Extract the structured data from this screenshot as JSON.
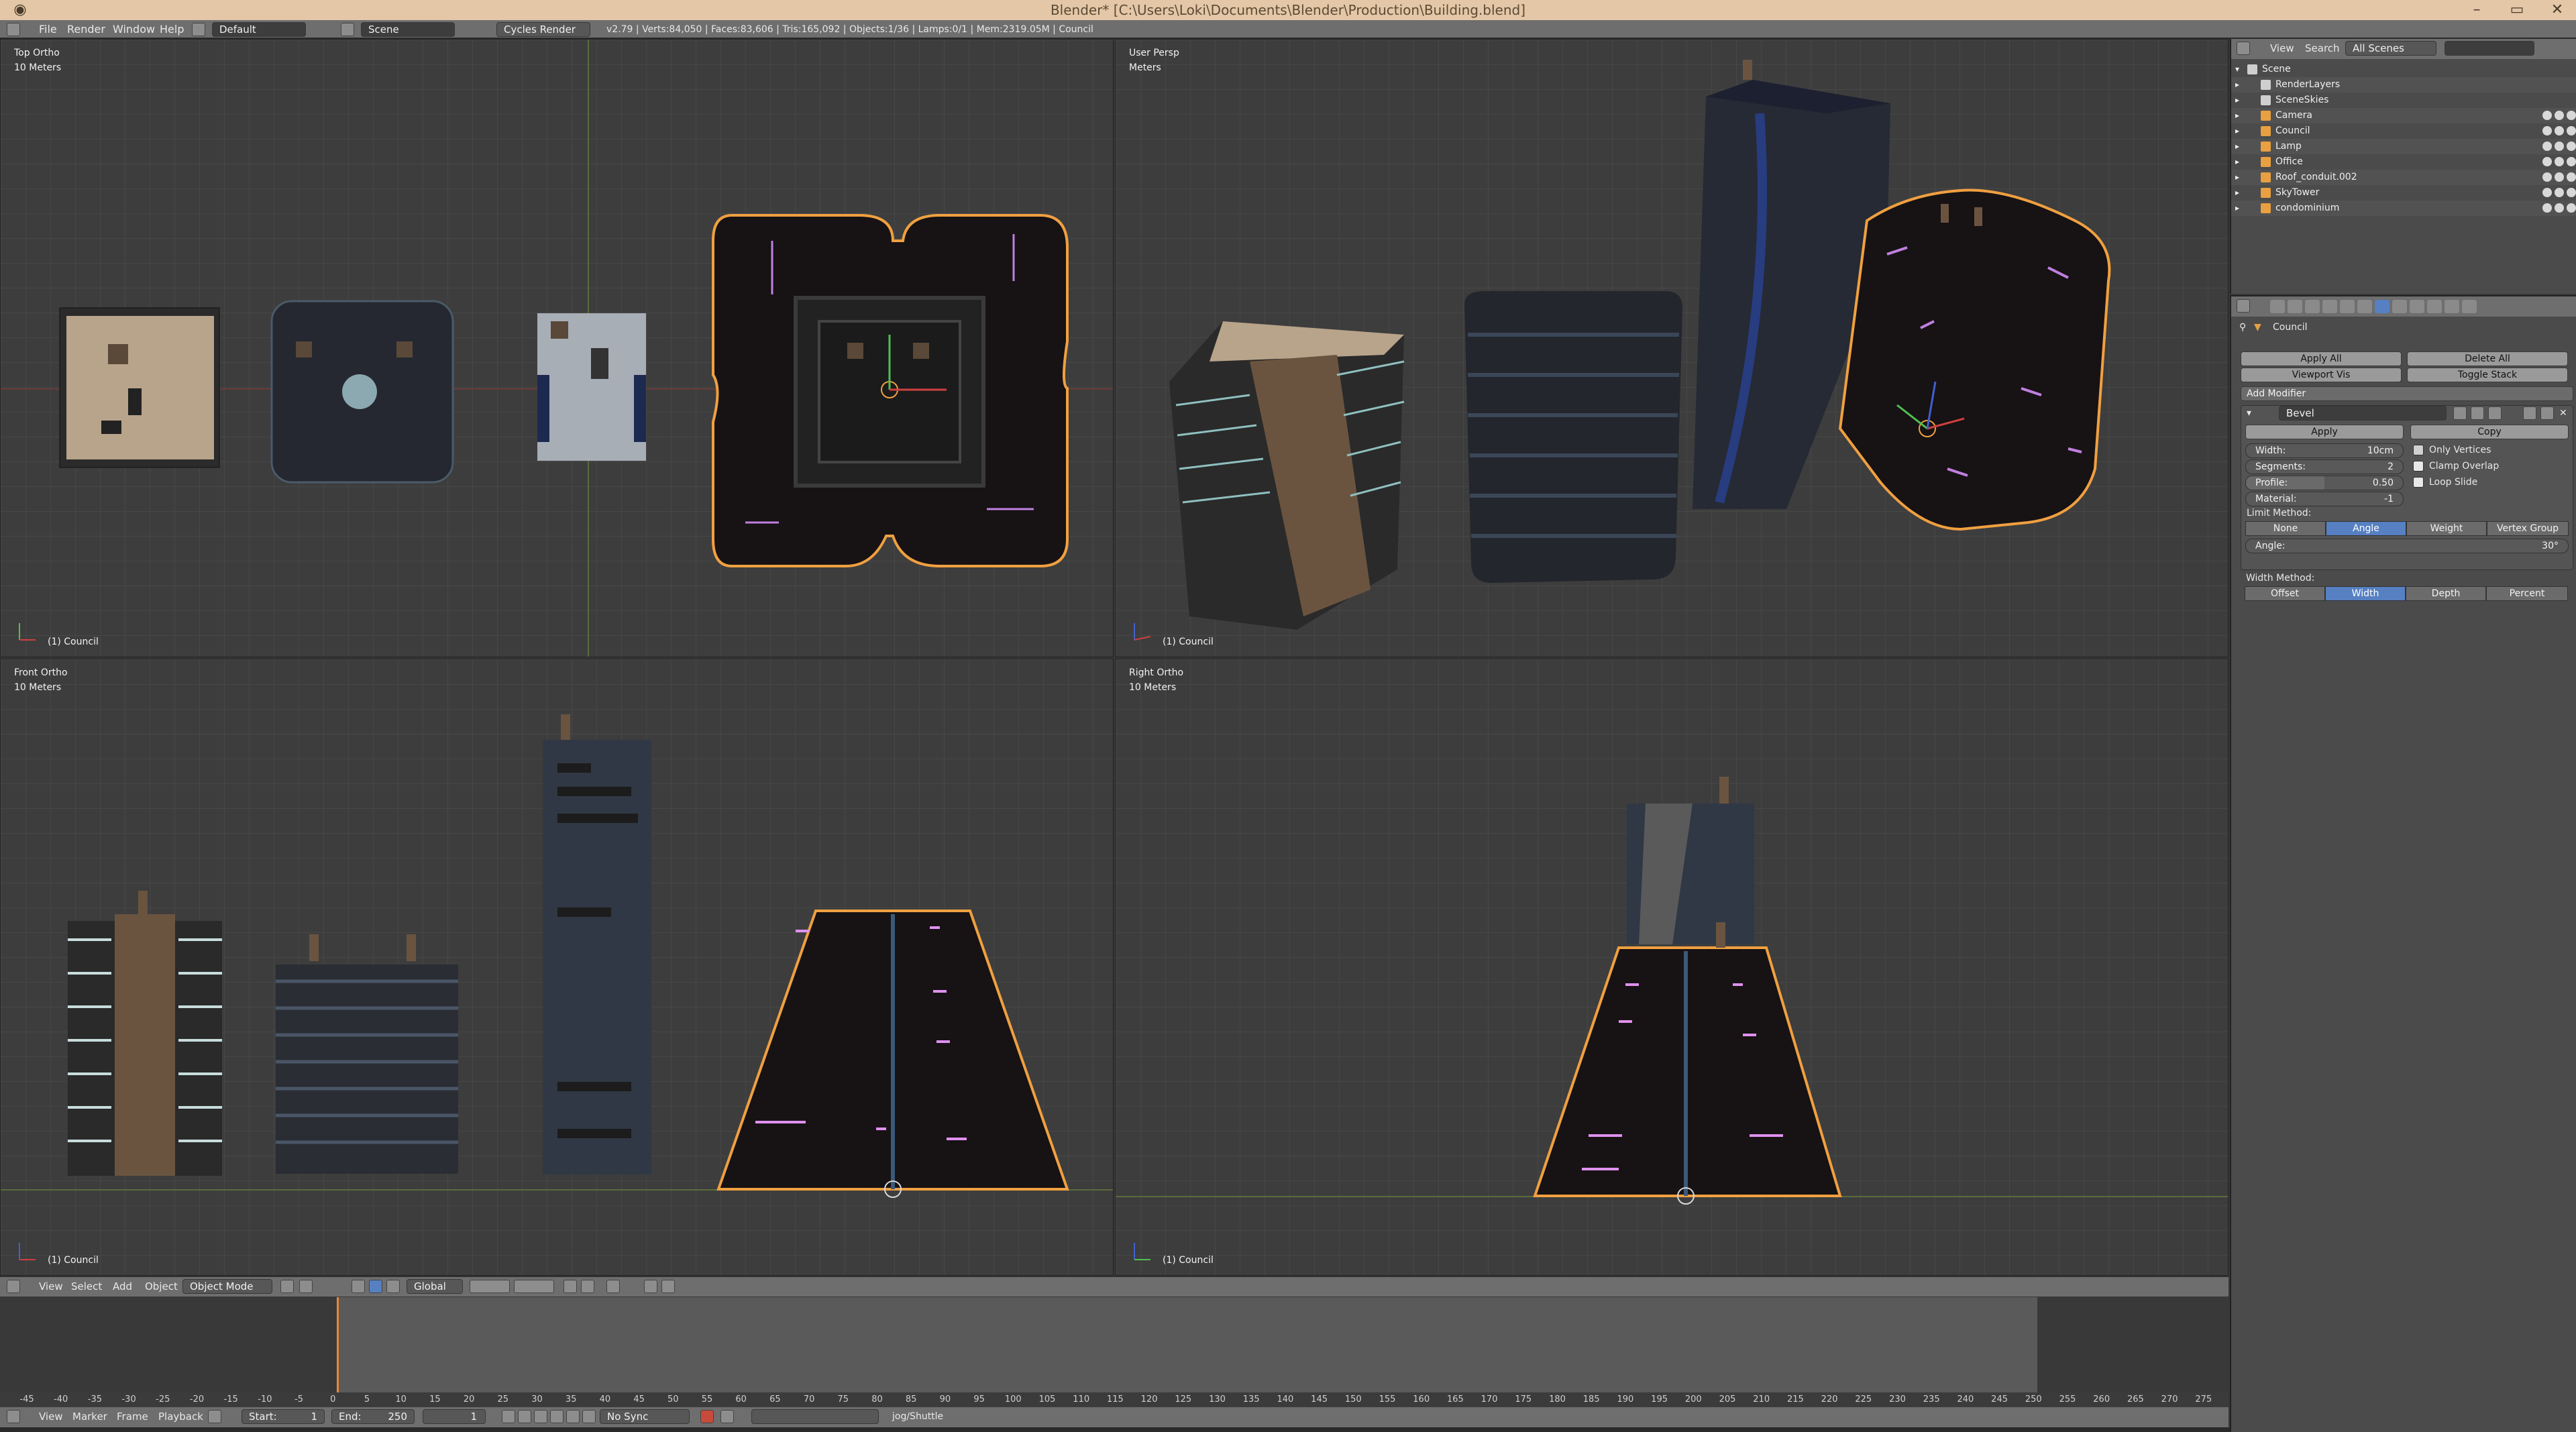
{
  "window": {
    "title": "Blender* [C:\\Users\\Loki\\Documents\\Blender\\Production\\Building.blend]"
  },
  "info_header": {
    "menus": [
      "File",
      "Render",
      "Window",
      "Help"
    ],
    "layout": "Default",
    "scene": "Scene",
    "engine": "Cycles Render",
    "stats": "v2.79 | Verts:84,050 | Faces:83,606 | Tris:165,092 | Objects:1/36 | Lamps:0/1 | Mem:2319.05M | Council"
  },
  "viewports": {
    "top": {
      "view": "Top Ortho",
      "scale": "10 Meters",
      "footer": "(1) Council"
    },
    "user": {
      "view": "User Persp",
      "scale": "Meters",
      "footer": "(1) Council"
    },
    "front": {
      "view": "Front Ortho",
      "scale": "10 Meters",
      "footer": "(1) Council"
    },
    "right": {
      "view": "Right Ortho",
      "scale": "10 Meters",
      "footer": "(1) Council"
    }
  },
  "view3d_header": {
    "menus": [
      "View",
      "Select",
      "Add",
      "Object"
    ],
    "mode": "Object Mode",
    "orientation": "Global"
  },
  "timeline": {
    "ruler": [
      "-45",
      "-40",
      "-35",
      "-30",
      "-25",
      "-20",
      "-15",
      "-10",
      "-5",
      "0",
      "5",
      "10",
      "15",
      "20",
      "25",
      "30",
      "35",
      "40",
      "45",
      "50",
      "55",
      "60",
      "65",
      "70",
      "75",
      "80",
      "85",
      "90",
      "95",
      "100",
      "105",
      "110",
      "115",
      "120",
      "125",
      "130",
      "135",
      "140",
      "145",
      "150",
      "155",
      "160",
      "165",
      "170",
      "175",
      "180",
      "185",
      "190",
      "195",
      "200",
      "205",
      "210",
      "215",
      "220",
      "225",
      "230",
      "235",
      "240",
      "245",
      "250",
      "255",
      "260",
      "265",
      "270",
      "275"
    ],
    "menus": [
      "View",
      "Marker",
      "Frame",
      "Playback"
    ],
    "start": "Start:",
    "start_value": "1",
    "end": "End:",
    "end_value": "250",
    "current": "1",
    "sync": "No Sync",
    "keying_set": "jog/Shuttle"
  },
  "outliner": {
    "menus": [
      "View",
      "Search"
    ],
    "display": "All Scenes",
    "items": [
      {
        "label": "Scene",
        "icon_color": "#cfcfcf"
      },
      {
        "label": "RenderLayers",
        "icon_color": "#cfcfcf"
      },
      {
        "label": "SceneSkies",
        "icon_color": "#cfcfcf"
      },
      {
        "label": "Camera",
        "icon_color": "#e8a040"
      },
      {
        "label": "Council",
        "icon_color": "#e8a040"
      },
      {
        "label": "Lamp",
        "icon_color": "#e8a040"
      },
      {
        "label": "Office",
        "icon_color": "#e8a040"
      },
      {
        "label": "Roof_conduit.002",
        "icon_color": "#e8a040"
      },
      {
        "label": "SkyTower",
        "icon_color": "#e8a040"
      },
      {
        "label": "condominium",
        "icon_color": "#e8a040"
      }
    ]
  },
  "properties": {
    "object": "Council",
    "apply_all": "Apply All",
    "delete_all": "Delete All",
    "viewport_vis": "Viewport Vis",
    "toggle_stack": "Toggle Stack",
    "add_modifier": "Add Modifier",
    "modifier_name": "Bevel",
    "apply": "Apply",
    "copy": "Copy",
    "width_label": "Width:",
    "width_value": "10cm",
    "segments_label": "Segments:",
    "segments_value": "2",
    "profile_label": "Profile:",
    "profile_value": "0.50",
    "material_label": "Material:",
    "material_value": "-1",
    "only_vertices": "Only Vertices",
    "clamp_overlap": "Clamp Overlap",
    "loop_slide": "Loop Slide",
    "limit_method": "Limit Method:",
    "limit_options": [
      "None",
      "Angle",
      "Weight",
      "Vertex Group"
    ],
    "angle_label": "Angle:",
    "angle_value": "30°",
    "width_method": "Width Method:",
    "width_options": [
      "Offset",
      "Width",
      "Depth",
      "Percent"
    ]
  },
  "colors": {
    "selection": "#f0a040",
    "active_button": "#5680c2",
    "titlebar": "#e3c7a6"
  }
}
